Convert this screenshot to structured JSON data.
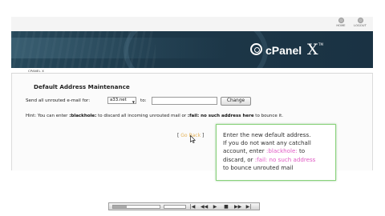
{
  "topnav": {
    "home_label": "HOME",
    "logout_label": "LOGOUT"
  },
  "banner": {
    "logo_text": "cPanel",
    "logo_version": "X",
    "logo_tm": "TM",
    "brand_color": "#1d3849"
  },
  "breadcrumb": {
    "text": "CPANEL X"
  },
  "main": {
    "title": "Default Address Maintenance",
    "send_label": "Send all unrouted e-mail for:",
    "domain_value": "a33.net",
    "to_label": "to:",
    "destination_value": "",
    "change_label": "Change",
    "hint_prefix": "Hint: You can enter ",
    "hint_blackhole": ":blackhole:",
    "hint_middle": " to discard all incoming unrouted mail or ",
    "hint_fail": ":fail: no such address here",
    "hint_suffix": " to bounce it.",
    "go_back_open": "[ ",
    "go_back_label": "Go Back",
    "go_back_close": " ]"
  },
  "tooltip": {
    "line1": "Enter the new default address.",
    "line2": "If you do not want any catchall",
    "line3a": "account, enter ",
    "blackhole": ":blackhole:",
    "line3b": " to",
    "line4a": "discard, or ",
    "fail": ":fail: no such address",
    "line5": "to bounce unrouted mail",
    "highlight_color": "#e05ac4",
    "border_color": "#8ad27c"
  },
  "player": {
    "progress": 0.3,
    "buttons": [
      "|◀",
      "◀◀",
      "▶",
      "■",
      "▶▶",
      "▶|"
    ]
  }
}
